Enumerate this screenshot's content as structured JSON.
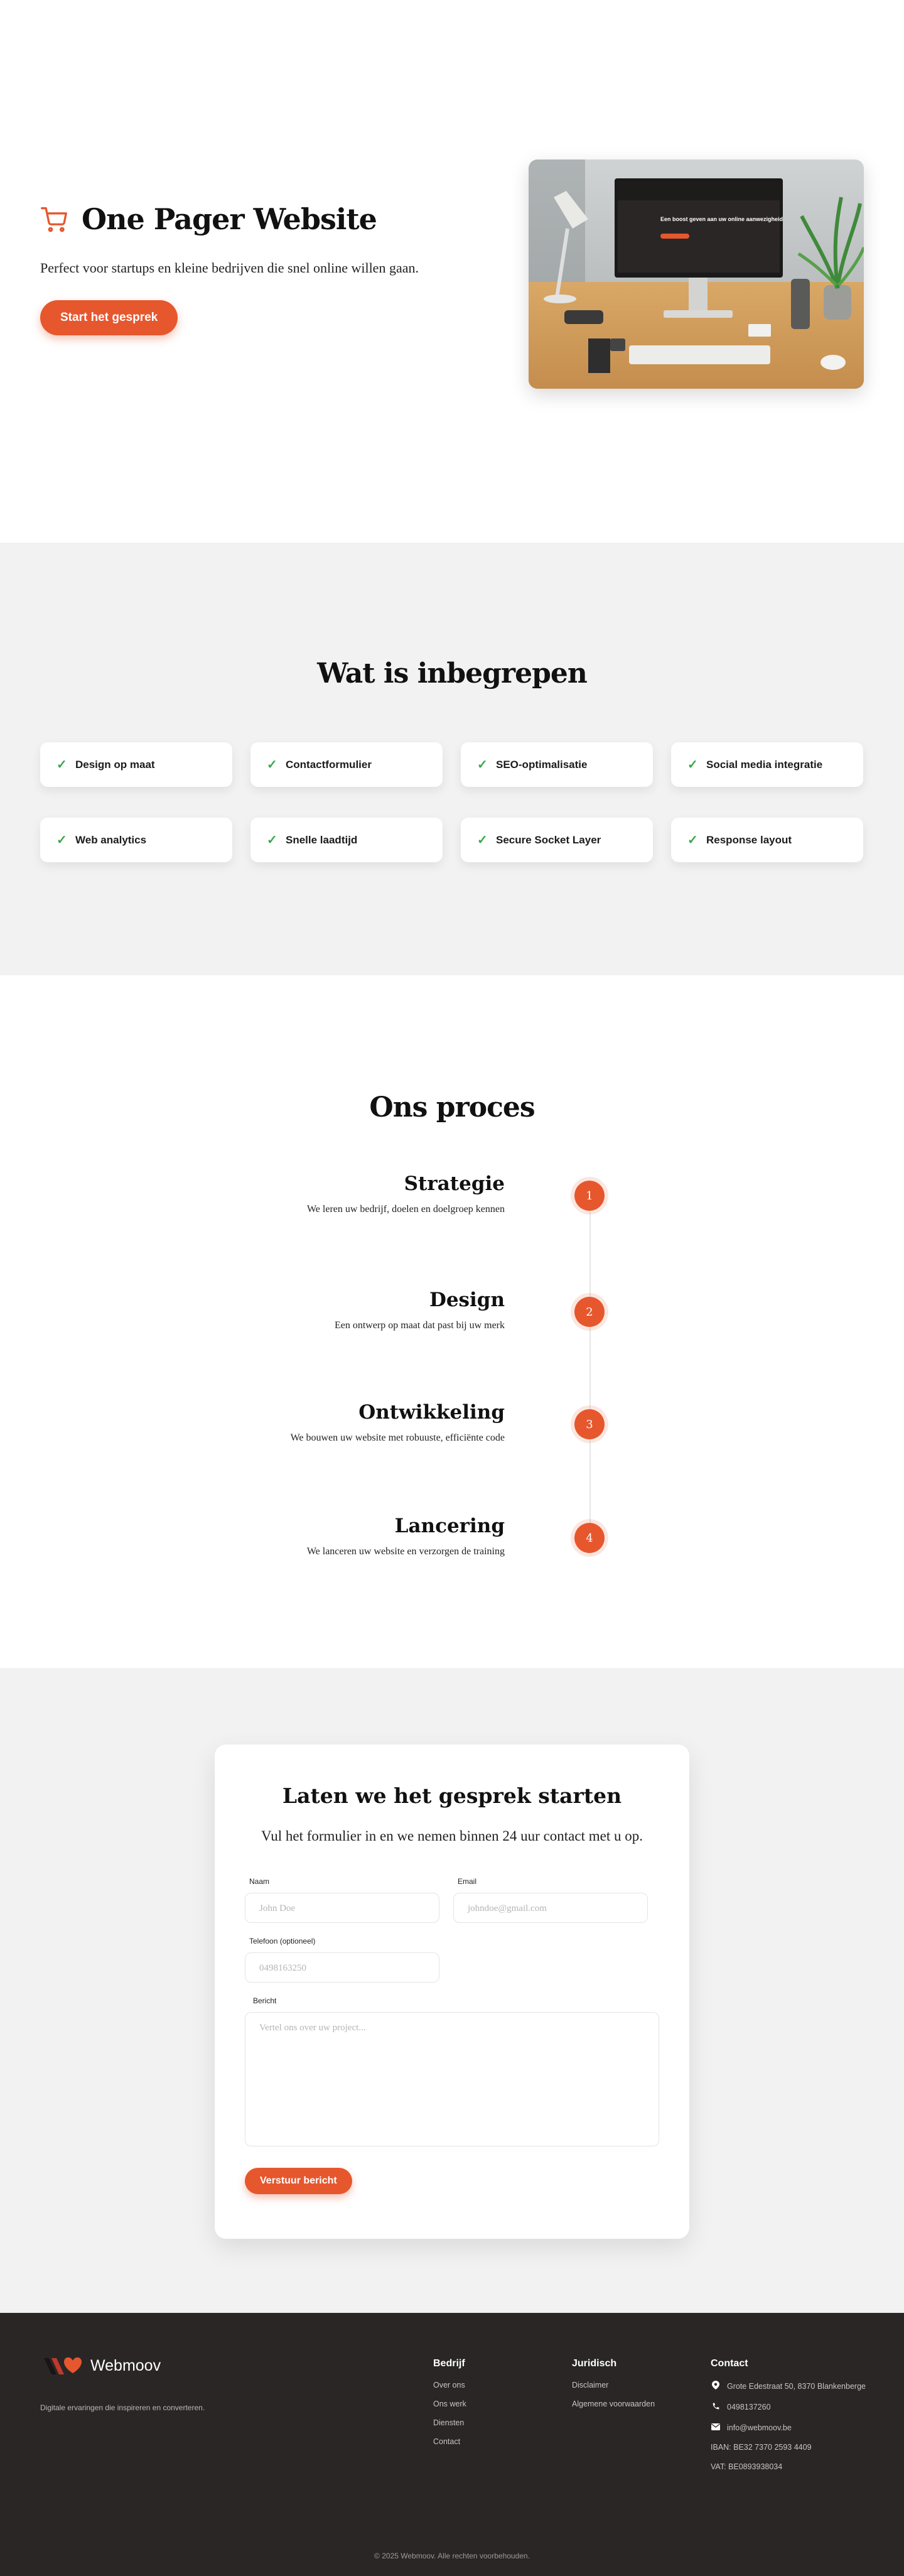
{
  "hero": {
    "title": "One Pager Website",
    "subtitle": "Perfect voor startups en kleine bedrijven die snel online willen gaan.",
    "cta_label": "Start het gesprek",
    "image_screen_text": "Een boost geven aan uw online aanwezigheid"
  },
  "included": {
    "heading": "Wat is inbegrepen",
    "items": [
      {
        "label": "Design op maat"
      },
      {
        "label": "Contactformulier"
      },
      {
        "label": "SEO-optimalisatie"
      },
      {
        "label": "Social media integratie"
      },
      {
        "label": "Web analytics"
      },
      {
        "label": "Snelle laadtijd"
      },
      {
        "label": "Secure Socket Layer"
      },
      {
        "label": "Response layout"
      }
    ]
  },
  "process": {
    "heading": "Ons proces",
    "steps": [
      {
        "num": "1",
        "title": "Strategie",
        "desc": "We leren uw bedrijf, doelen en doelgroep kennen"
      },
      {
        "num": "2",
        "title": "Design",
        "desc": "Een ontwerp op maat dat past bij uw merk"
      },
      {
        "num": "3",
        "title": "Ontwikkeling",
        "desc": "We bouwen uw website met robuuste, efficiënte code"
      },
      {
        "num": "4",
        "title": "Lancering",
        "desc": "We lanceren uw website en verzorgen de training"
      }
    ]
  },
  "contact": {
    "title": "Laten we het gesprek starten",
    "subtitle": "Vul het formulier in en we nemen binnen 24 uur contact met u op.",
    "name_label": "Naam",
    "name_placeholder": "John Doe",
    "email_label": "Email",
    "email_placeholder": "johndoe@gmail.com",
    "phone_label": "Telefoon (optioneel)",
    "phone_placeholder": "0498163250",
    "message_label": "Bericht",
    "message_placeholder": "Vertel ons over uw project...",
    "submit_label": "Verstuur bericht"
  },
  "footer": {
    "brand": "Webmoov",
    "tagline": "Digitale ervaringen die inspireren en converteren.",
    "company": {
      "heading": "Bedrijf",
      "links": [
        "Over ons",
        "Ons werk",
        "Diensten",
        "Contact"
      ]
    },
    "legal": {
      "heading": "Juridisch",
      "links": [
        "Disclaimer",
        "Algemene voorwaarden"
      ]
    },
    "contact": {
      "heading": "Contact",
      "address": "Grote Edestraat 50, 8370 Blankenberge",
      "phone": "0498137260",
      "email": "info@webmoov.be",
      "iban": "IBAN: BE32 7370 2593 4409",
      "vat": "VAT: BE0893938034"
    },
    "copyright": "© 2025 Webmoov. Alle rechten voorbehouden.",
    "accent_color": "#e6572e"
  }
}
